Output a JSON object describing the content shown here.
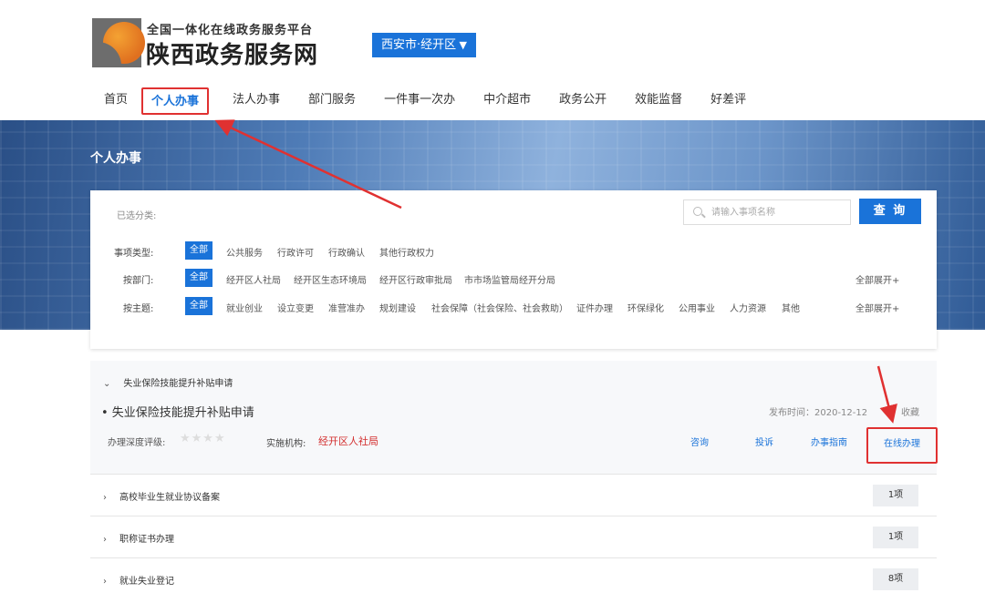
{
  "header": {
    "subtitle": "全国一体化在线政务服务平台",
    "title": "陕西政务服务网",
    "city": "西安市·经开区"
  },
  "nav": {
    "items": [
      "首页",
      "个人办事",
      "法人办事",
      "部门服务",
      "一件事一次办",
      "中介超市",
      "政务公开",
      "效能监督",
      "好差评"
    ],
    "active_index": 1
  },
  "banner": {
    "title": "个人办事"
  },
  "filter": {
    "selected_label": "已选分类:",
    "search": {
      "placeholder": "请输入事项名称",
      "value": ""
    },
    "query_label": "查 询",
    "rows": [
      {
        "label": "事项类型:",
        "options": [
          "全部",
          "公共服务",
          "行政许可",
          "行政确认",
          "其他行政权力"
        ],
        "expand": ""
      },
      {
        "label": "按部门:",
        "options": [
          "全部",
          "经开区人社局",
          "经开区生态环境局",
          "经开区行政审批局",
          "市市场监管局经开分局"
        ],
        "expand": "全部展开+"
      },
      {
        "label": "按主题:",
        "options": [
          "全部",
          "就业创业",
          "设立变更",
          "准营准办",
          "规划建设",
          "社会保障（社会保险、社会救助）",
          "证件办理",
          "环保绿化",
          "公用事业",
          "人力资源",
          "其他"
        ],
        "expand": "全部展开+"
      }
    ]
  },
  "results": {
    "open_group": {
      "caret": "⌄",
      "name": "失业保险技能提升补贴申请",
      "item_title": "• 失业保险技能提升补贴申请",
      "publish": "发布时间：2020-12-12",
      "favorite": "收藏",
      "depth_label": "办理深度评级:",
      "stars": "★★★★",
      "org_label": "实施机构:",
      "org_value": "经开区人社局",
      "actions": [
        "咨询",
        "投诉",
        "办事指南",
        "在线办理"
      ]
    },
    "groups": [
      {
        "caret": "›",
        "name": "高校毕业生就业协议备案",
        "count": "1项"
      },
      {
        "caret": "›",
        "name": "职称证书办理",
        "count": "1项"
      },
      {
        "caret": "›",
        "name": "就业失业登记",
        "count": "8项"
      }
    ]
  },
  "colors": {
    "accent": "#1a73d9",
    "annotation": "#e03131",
    "org": "#d32f2f"
  }
}
